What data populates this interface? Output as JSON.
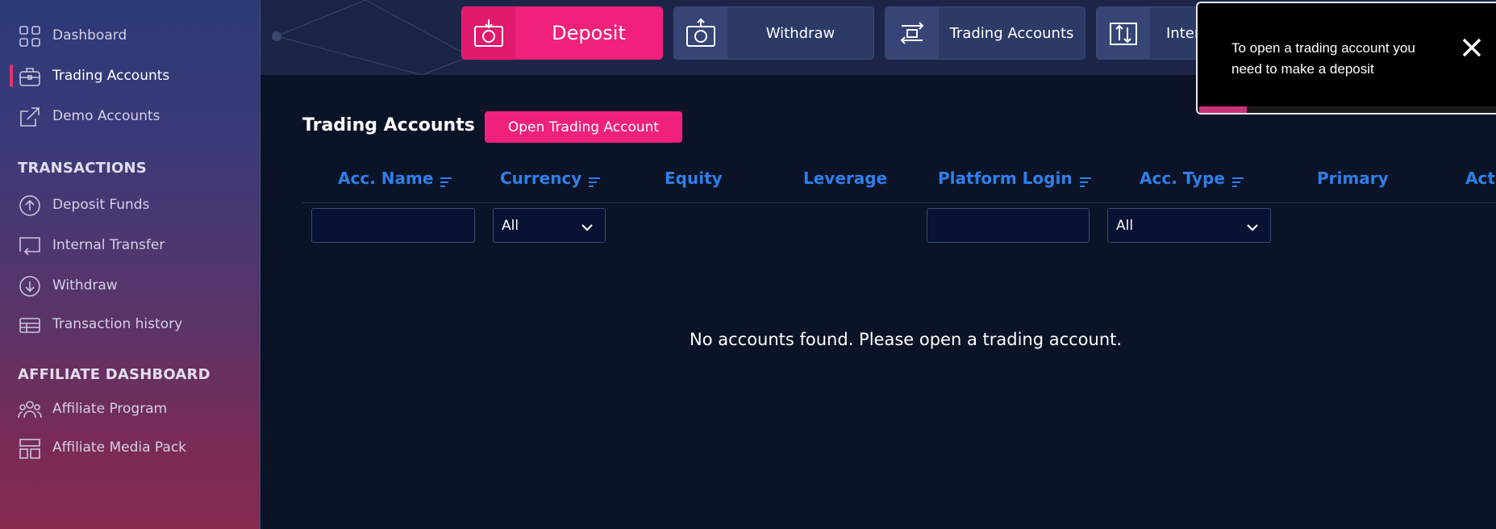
{
  "sidebar": {
    "items": [
      {
        "label": "Dashboard",
        "icon": "grid-icon"
      },
      {
        "label": "Trading Accounts",
        "icon": "briefcase-icon",
        "active": true
      },
      {
        "label": "Demo Accounts",
        "icon": "external-link-icon"
      }
    ],
    "transactions_title": "TRANSACTIONS",
    "transactions": [
      {
        "label": "Deposit Funds",
        "icon": "arrow-up-circle-icon"
      },
      {
        "label": "Internal Transfer",
        "icon": "transfer-icon"
      },
      {
        "label": "Withdraw",
        "icon": "arrow-down-circle-icon"
      },
      {
        "label": "Transaction history",
        "icon": "table-icon"
      }
    ],
    "affiliate_title": "AFFILIATE DASHBOARD",
    "affiliate": [
      {
        "label": "Affiliate Program",
        "icon": "users-icon"
      },
      {
        "label": "Affiliate Media Pack",
        "icon": "layout-icon"
      }
    ]
  },
  "topbar": {
    "deposit": "Deposit",
    "withdraw": "Withdraw",
    "trading_accounts": "Trading Accounts",
    "internal": "Inter"
  },
  "main": {
    "title": "Trading Accounts",
    "open_button": "Open Trading Account",
    "columns": [
      "Acc. Name",
      "Currency",
      "Equity",
      "Leverage",
      "Platform Login",
      "Acc. Type",
      "Primary",
      "Act"
    ],
    "filters": {
      "acc_name_value": "",
      "currency_selected": "All",
      "platform_login_value": "",
      "acc_type_selected": "All"
    },
    "empty_message": "No accounts found. Please open a trading account."
  },
  "toast": {
    "message": "To open a trading account you need to make a deposit",
    "progress": 0.16
  },
  "colors": {
    "accent": "#f0217a",
    "column_header": "#2f7fe8",
    "background": "#0b1327"
  }
}
